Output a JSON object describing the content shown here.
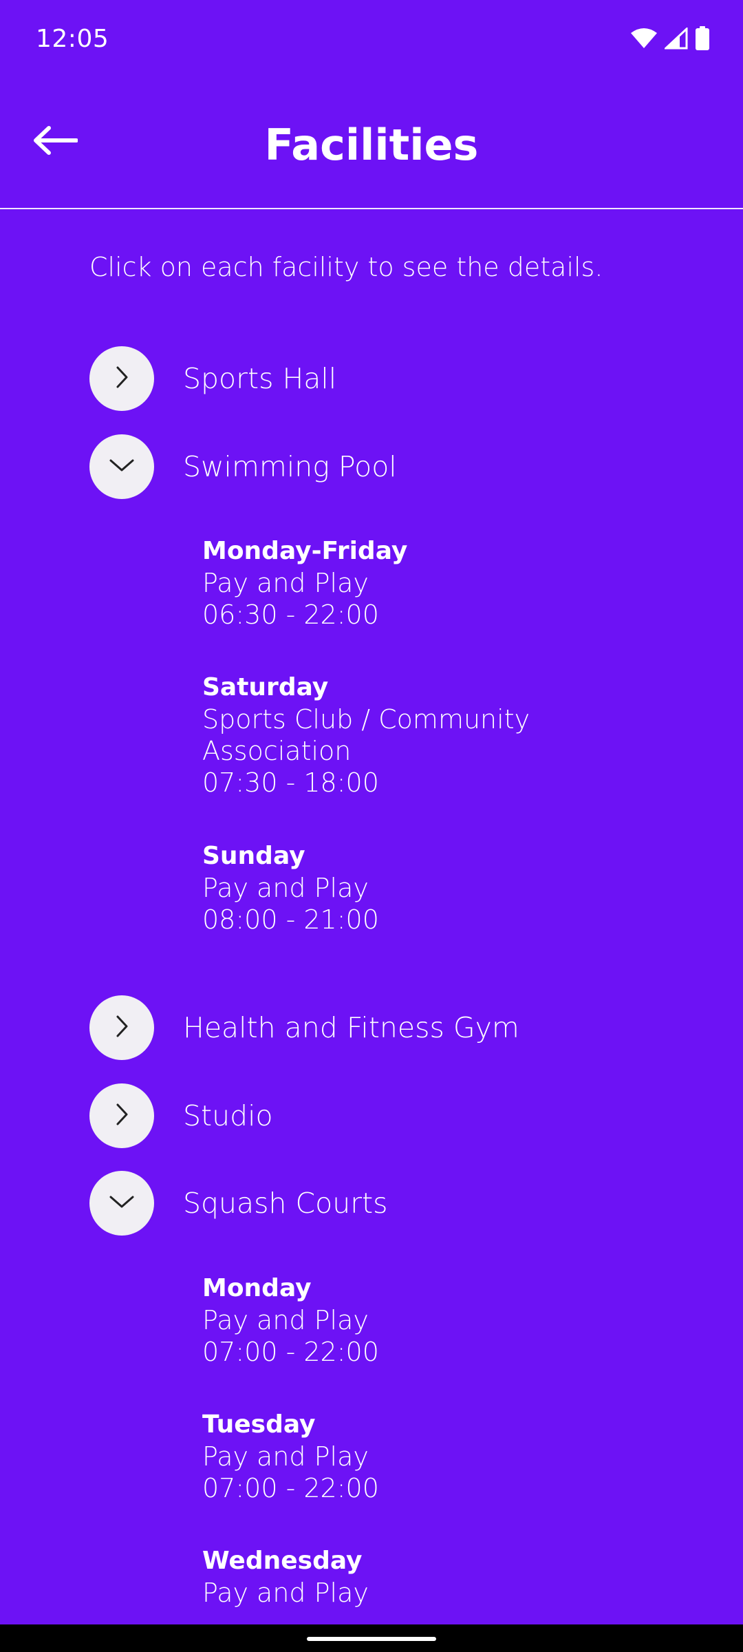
{
  "status_bar": {
    "time": "12:05",
    "icons": [
      "wifi-icon",
      "cell-signal-icon",
      "battery-icon"
    ]
  },
  "app_bar": {
    "title": "Facilities",
    "back_icon": "arrow-left-icon"
  },
  "intro_text": "Click on each facility to see the details.",
  "colors": {
    "background": "#6d12f5",
    "toggle_circle": "#f1eff4",
    "text": "#ffffff"
  },
  "facilities": [
    {
      "label": "Sports Hall",
      "expanded": false
    },
    {
      "label": "Swimming Pool",
      "expanded": true,
      "schedule": [
        {
          "day": "Monday-Friday",
          "lines": [
            "Pay and Play",
            "06:30 - 22:00"
          ]
        },
        {
          "day": "Saturday",
          "lines": [
            "Sports Club / Community",
            "Association",
            "07:30 - 18:00"
          ]
        },
        {
          "day": "Sunday",
          "lines": [
            "Pay and Play",
            "08:00 - 21:00"
          ]
        }
      ]
    },
    {
      "label": "Health and Fitness Gym",
      "expanded": false
    },
    {
      "label": "Studio",
      "expanded": false
    },
    {
      "label": "Squash Courts",
      "expanded": true,
      "schedule": [
        {
          "day": "Monday",
          "lines": [
            "Pay and Play",
            "07:00 - 22:00"
          ]
        },
        {
          "day": "Tuesday",
          "lines": [
            "Pay and Play",
            "07:00 - 22:00"
          ]
        },
        {
          "day": "Wednesday",
          "lines": [
            "Pay and Play"
          ]
        }
      ]
    }
  ]
}
